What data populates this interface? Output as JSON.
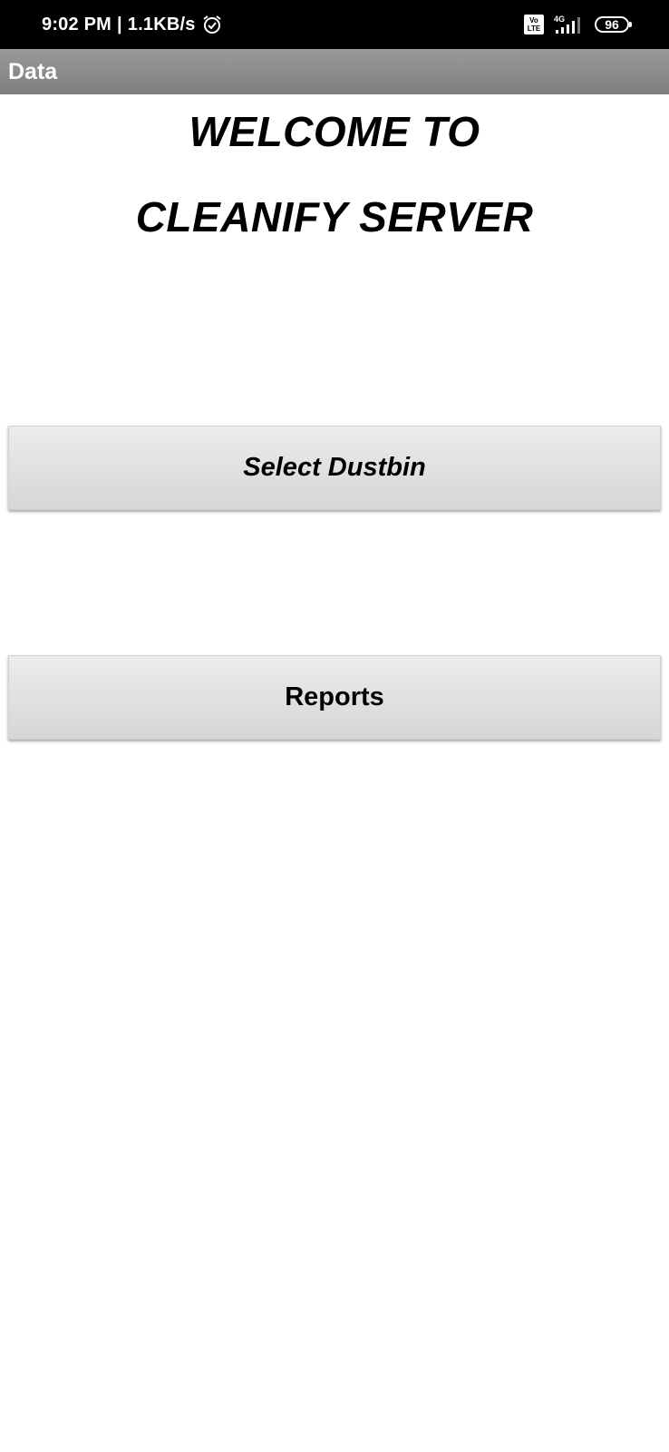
{
  "status_bar": {
    "time": "9:02 PM",
    "separator": "|",
    "net_speed": "1.1KB/s",
    "alarm_icon": "alarm-clock-icon",
    "volte_top": "Vo",
    "volte_bottom": "LTE",
    "network_type": "4G",
    "signal_icon": "signal-bars-icon",
    "battery_level": "96"
  },
  "app_bar": {
    "title": "Data"
  },
  "welcome": {
    "line1": "WELCOME TO",
    "line2": "CLEANIFY SERVER"
  },
  "buttons": {
    "select_dustbin": "Select Dustbin",
    "reports": "Reports"
  },
  "colors": {
    "status_bar_bg": "#000000",
    "app_bar_bg": "#8a8a8a",
    "button_bg": "#e0e0e0",
    "text": "#000000"
  }
}
